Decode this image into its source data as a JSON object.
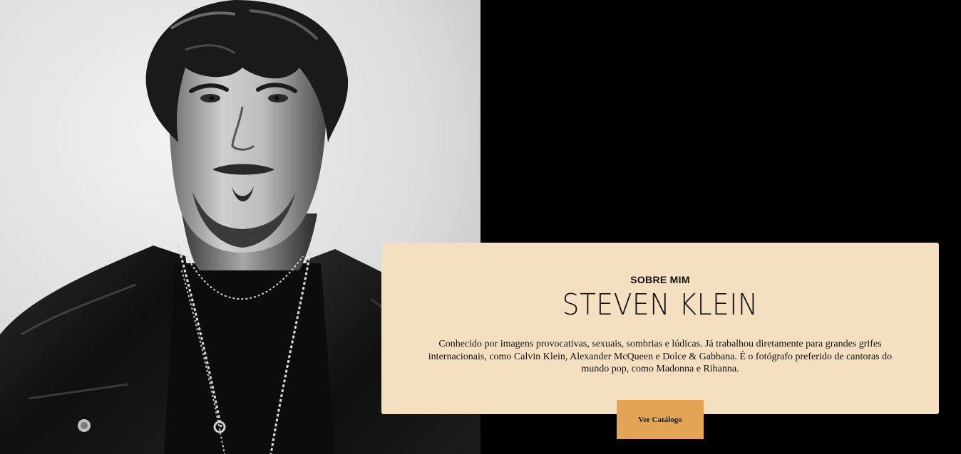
{
  "portrait": {
    "alt": "Steven Klein black and white portrait"
  },
  "about": {
    "kicker": "SOBRE MIM",
    "name": "STEVEN KLEIN",
    "text": "Conhecido por imagens provocativas, sexuais, sombrias e lúdicas. Já trabalhou diretamente para grandes grifes internacionais, como Calvin Klein, Alexander McQueen e Dolce & Gabbana. É o fotógrafo preferido de cantoras do mundo pop, como Madonna e Rihanna."
  },
  "cta": {
    "label": "Ver Catálogo"
  },
  "colors": {
    "background": "#000000",
    "card": "#f5dfc1",
    "button": "#e3a555",
    "text": "#111111"
  }
}
